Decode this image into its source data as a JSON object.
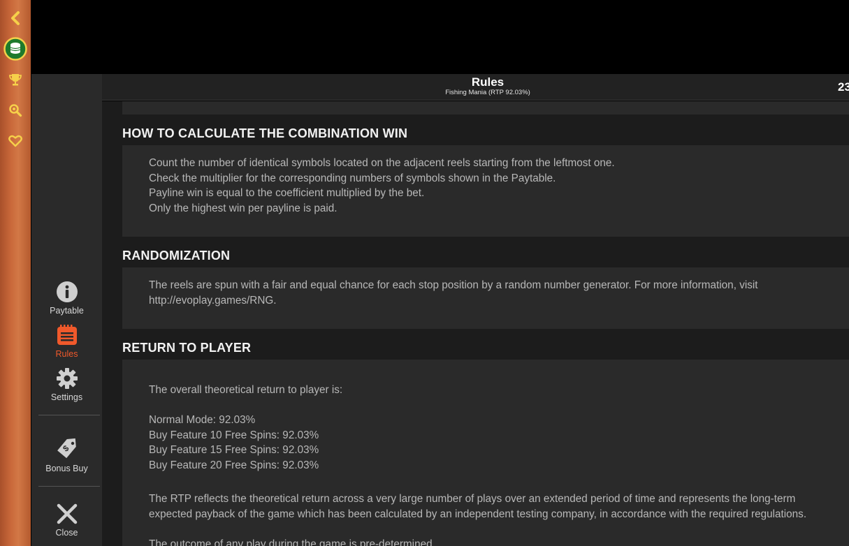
{
  "header": {
    "title": "Rules",
    "subtitle": "Fishing Mania (RTP 92.03%)",
    "clock": "23"
  },
  "rail": {
    "icons": [
      "chevron-left-icon",
      "coin-stack-icon",
      "trophy-icon",
      "magnifier-icon",
      "heart-icon"
    ]
  },
  "nav": {
    "paytable": "Paytable",
    "rules": "Rules",
    "settings": "Settings",
    "bonus_buy": "Bonus Buy",
    "close": "Close",
    "accent_color": "#f0592b"
  },
  "sections": {
    "combination": {
      "title": "HOW TO CALCULATE THE COMBINATION WIN",
      "lines": [
        "Count the number of identical symbols located on the adjacent reels starting from the leftmost one.",
        "Check the multiplier for the corresponding numbers of symbols shown in the Paytable.",
        "Payline win is equal to the coefficient multiplied by the bet.",
        "Only the highest win per payline is paid."
      ]
    },
    "randomization": {
      "title": "RANDOMIZATION",
      "text": "The reels are spun with a fair and equal chance for each stop position by a random number generator. For more information, visit http://evoplay.games/RNG."
    },
    "rtp": {
      "title": "RETURN TO PLAYER",
      "intro": "The overall theoretical return to player is:",
      "modes": [
        "Normal Mode: 92.03%",
        "Buy Feature 10 Free Spins: 92.03%",
        "Buy Feature 15 Free Spins: 92.03%",
        "Buy Feature 20 Free Spins: 92.03%"
      ],
      "explanation": "The RTP reflects the theoretical return across a very large number of plays over an extended period of time and represents the long-term expected payback of the game which has been calculated by an independent testing company, in accordance with the required regulations.",
      "predetermined": "The outcome of any play during the game is pre-determined."
    }
  }
}
